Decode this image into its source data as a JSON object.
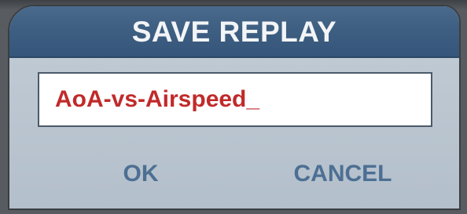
{
  "dialog": {
    "title": "SAVE REPLAY",
    "filename_value": "AoA-vs-Airspeed_",
    "ok_label": "OK",
    "cancel_label": "CANCEL"
  },
  "colors": {
    "titlebar": "#3e5f82",
    "title_text": "#f2f4f6",
    "dialog_body": "#b8c3ce",
    "input_text": "#c12a2a",
    "button_text": "#4d6f93"
  }
}
